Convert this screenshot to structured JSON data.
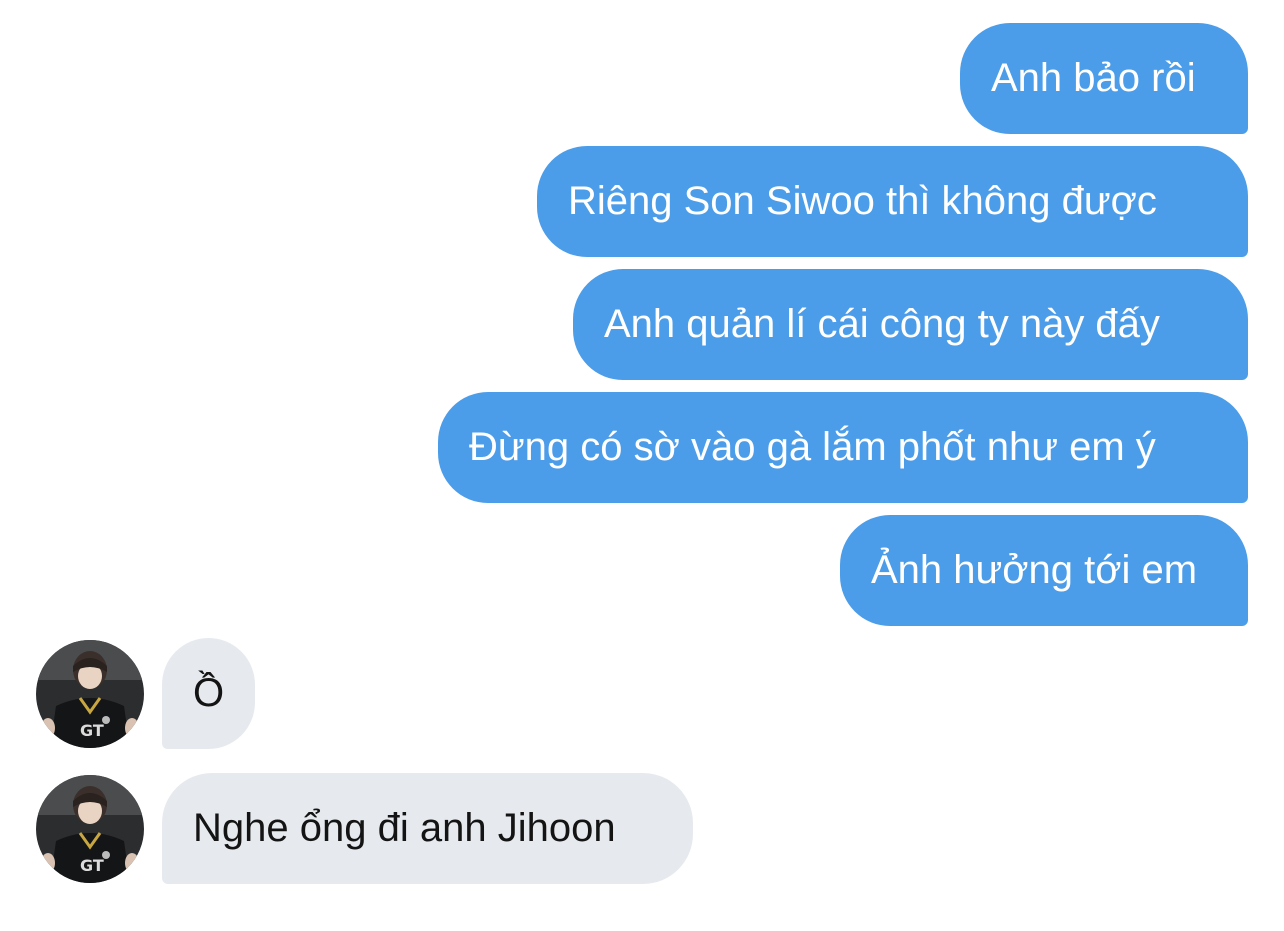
{
  "conversation": {
    "sent": [
      {
        "text": "Anh bảo rồi"
      },
      {
        "text": "Riêng Son Siwoo thì không được"
      },
      {
        "text": "Anh quản lí cái công ty này đấy"
      },
      {
        "text": "Đừng có sờ vào gà lắm phốt như em ý"
      },
      {
        "text": "Ảnh hưởng tới em"
      }
    ],
    "received": [
      {
        "text": "Ồ",
        "avatar_icon": "user-avatar-icon"
      },
      {
        "text": "Nghe ổng đi anh Jihoon",
        "avatar_icon": "user-avatar-icon"
      }
    ]
  },
  "colors": {
    "sent_bubble": "#4c9de9",
    "received_bubble": "#e6eaef",
    "sent_text": "#ffffff",
    "received_text": "#141414"
  }
}
